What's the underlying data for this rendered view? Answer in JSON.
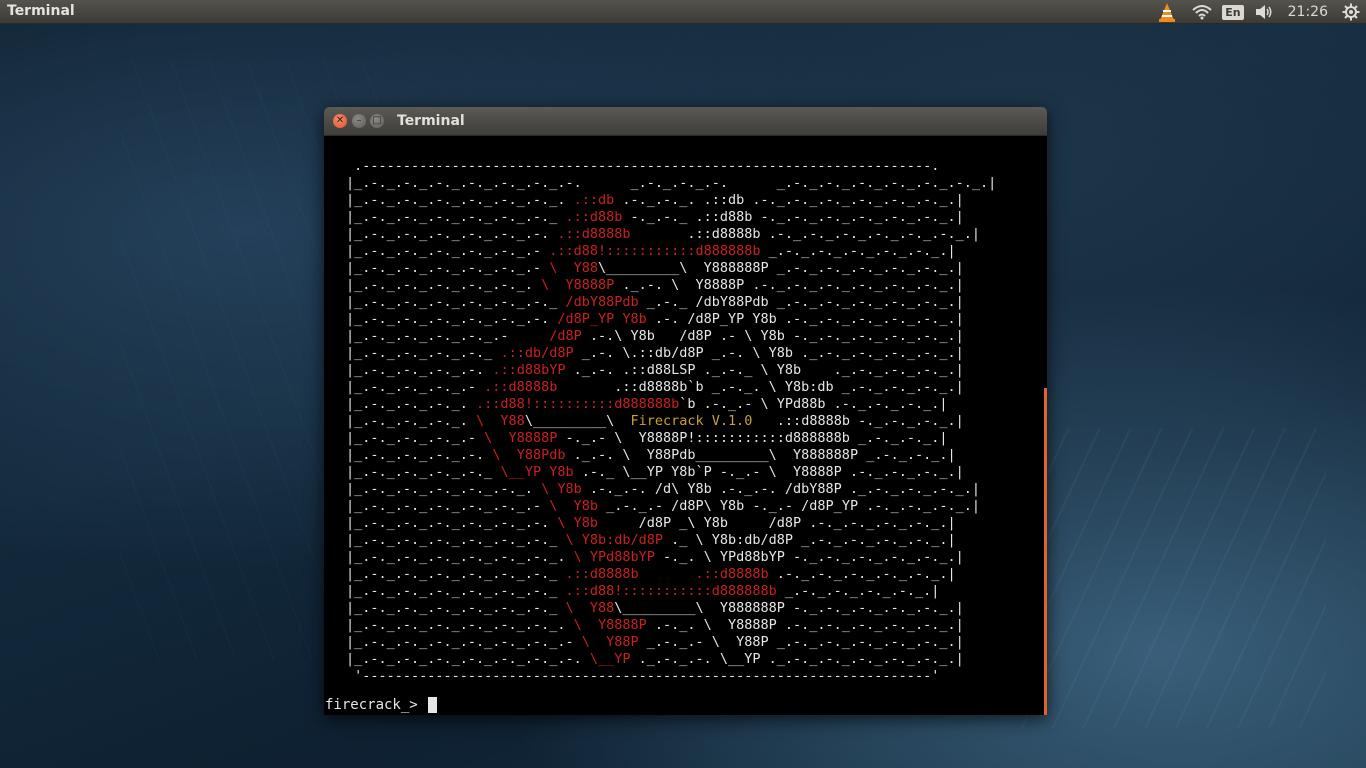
{
  "panel": {
    "title": "Terminal",
    "keyboard_layout": "En",
    "clock": "21:26",
    "icons": [
      "vlc-icon",
      "wifi-icon",
      "keyboard-layout-icon",
      "volume-icon",
      "settings-gear-icon"
    ]
  },
  "window": {
    "title": "Terminal",
    "buttons": [
      "close",
      "minimize",
      "maximize"
    ]
  },
  "terminal": {
    "banner_label": "Firecrack V.1.0",
    "prompt": "firecrack_>",
    "colors": {
      "text": "#e6e6e6",
      "red": "#cc1f1f",
      "yellow": "#c9a227",
      "background": "#000000",
      "scrollbar": "#e0622d"
    }
  }
}
